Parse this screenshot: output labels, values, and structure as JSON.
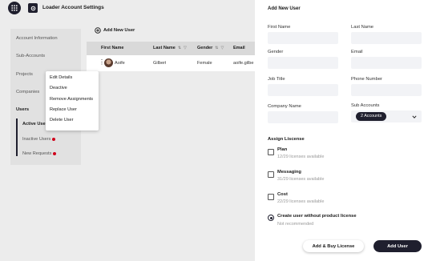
{
  "header": {
    "title": "Loader Account Settings"
  },
  "sidebar": {
    "items": [
      {
        "label": "Account Information"
      },
      {
        "label": "Sub-Accounts"
      },
      {
        "label": "Projects"
      },
      {
        "label": "Companies"
      },
      {
        "label": "Users"
      }
    ],
    "users_sub": [
      {
        "label": "Active Users",
        "active": true
      },
      {
        "label": "Inactive Users",
        "dot": true
      },
      {
        "label": "New Requests",
        "dot": true
      }
    ]
  },
  "main": {
    "add_user_label": "Add New User",
    "columns": [
      "First Name",
      "Last Name",
      "Gender",
      "Email"
    ],
    "rows": [
      {
        "first_name": "Aoife",
        "last_name": "Gilbert",
        "gender": "Female",
        "email": "aoife.gilbe"
      }
    ]
  },
  "context_menu": {
    "items": [
      "Edit Details",
      "Deactive",
      "Remove Assignments",
      "Replace User",
      "Delete User"
    ]
  },
  "panel": {
    "title": "Add New User",
    "fields": {
      "first_name": "First Name",
      "last_name": "Last Name",
      "gender": "Gender",
      "email": "Email",
      "job_title": "Job Title",
      "phone": "Phone Number",
      "company": "Company Name",
      "sub_accounts": "Sub Accounts"
    },
    "sub_accounts_value": "2 Accounts",
    "license_section_title": "Assign Liscense",
    "licenses": [
      {
        "name": "Plan",
        "available": "12/29 licenses available",
        "checked": false
      },
      {
        "name": "Messaging",
        "available": "31/29 licenses available",
        "checked": false
      },
      {
        "name": "Cost",
        "available": "22/29 licenses available",
        "checked": false
      }
    ],
    "no_license_option": {
      "name": "Create user without product license",
      "sub": "Not recommended",
      "selected": true
    },
    "buttons": {
      "add_buy": "Add & Buy License",
      "add_user": "Add User"
    }
  },
  "colors": {
    "accent": "#1f1f2e",
    "notification_dot": "#d0021b"
  },
  "icons": [
    "app-grid-icon",
    "settings-gear-icon",
    "add-circle-icon",
    "sort-icon",
    "filter-icon",
    "kebab-menu-icon",
    "chevron-down-icon"
  ]
}
